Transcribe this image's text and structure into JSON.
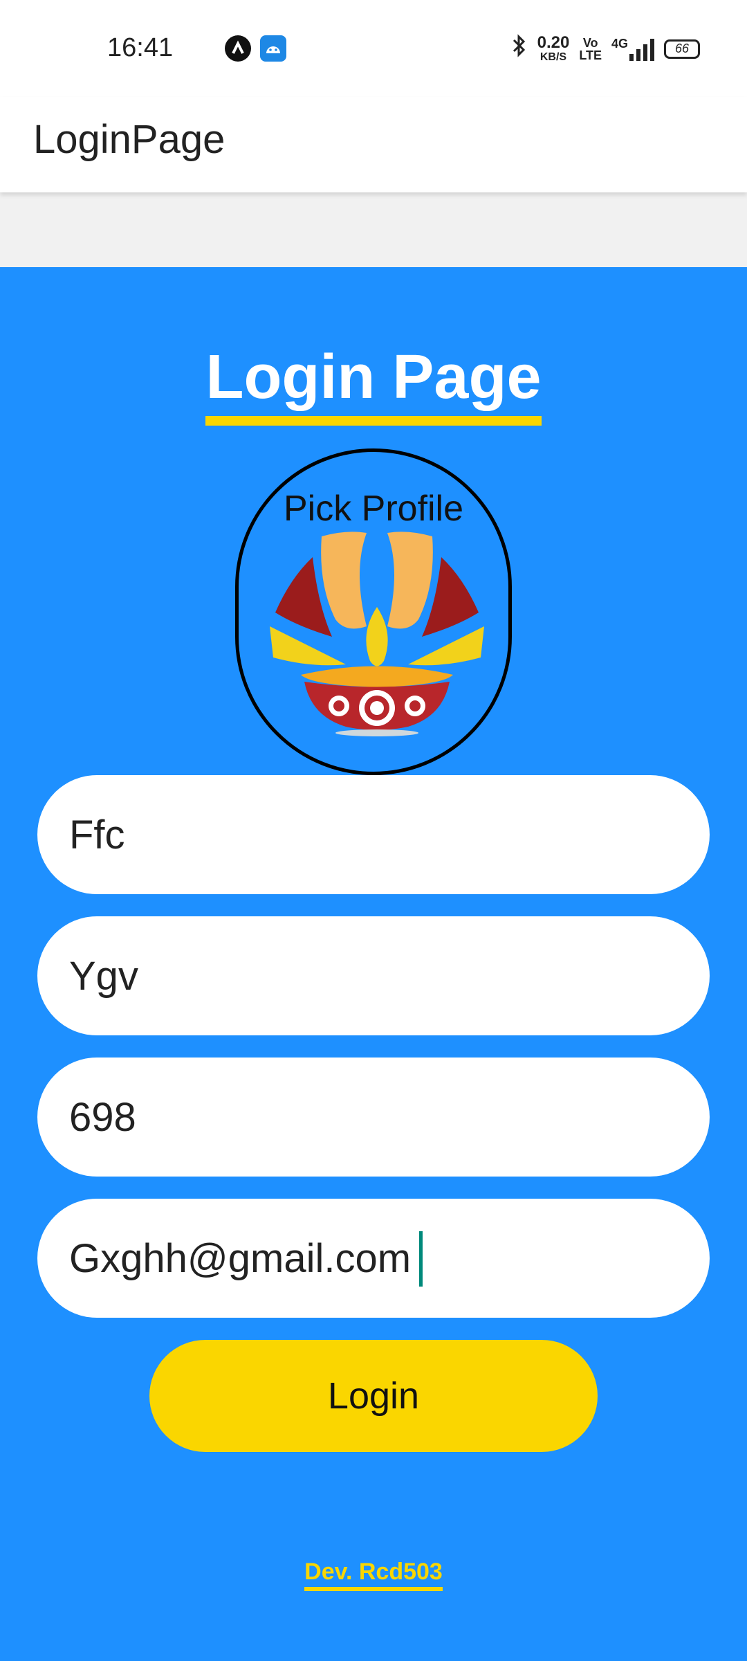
{
  "status_bar": {
    "time": "16:41",
    "net_speed_value": "0.20",
    "net_speed_unit": "KB/S",
    "volte_top": "Vo",
    "volte_bottom": "LTE",
    "network": "4G",
    "battery": "66",
    "icons": [
      "a-app-icon",
      "android-icon",
      "bluetooth-icon",
      "signal-icon",
      "battery-icon"
    ]
  },
  "app_bar": {
    "title": "LoginPage"
  },
  "main": {
    "heading": "Login Page",
    "profile_picker_label": "Pick Profile",
    "fields": [
      {
        "value": "Ffc"
      },
      {
        "value": "Ygv"
      },
      {
        "value": "698"
      },
      {
        "value": "Gxghh@gmail.com"
      }
    ],
    "login_label": "Login",
    "dev_credit": "Dev. Rcd503"
  },
  "colors": {
    "background": "#1e90ff",
    "accent": "#fad600",
    "field_bg": "#ffffff",
    "caret": "#00897b"
  }
}
